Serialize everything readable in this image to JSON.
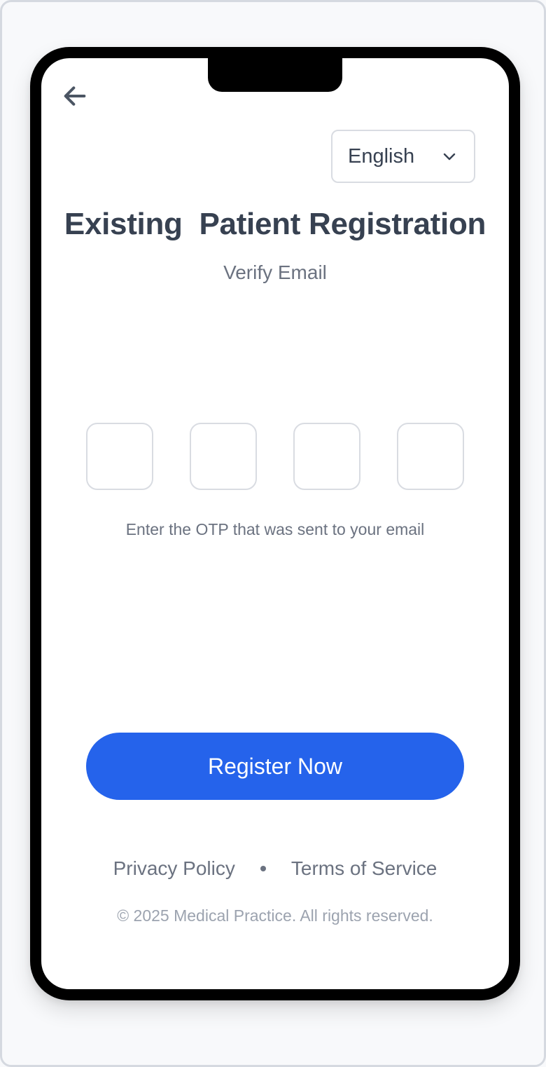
{
  "header": {
    "back_icon": "arrow-left-icon",
    "language": {
      "selected": "English",
      "icon": "chevron-down-icon"
    }
  },
  "main": {
    "title": "Existing  Patient Registration",
    "subtitle": "Verify Email",
    "otp": {
      "digits": [
        "",
        "",
        "",
        ""
      ],
      "help_text": "Enter the OTP that was sent to your email"
    },
    "register_label": "Register Now"
  },
  "footer": {
    "privacy_label": "Privacy Policy",
    "terms_label": "Terms of Service",
    "copyright": "© 2025 Medical Practice. All rights reserved."
  },
  "colors": {
    "accent": "#2563eb",
    "heading": "#374151",
    "muted": "#6b7280",
    "faint": "#9ca3af",
    "border": "#d9dce2"
  }
}
